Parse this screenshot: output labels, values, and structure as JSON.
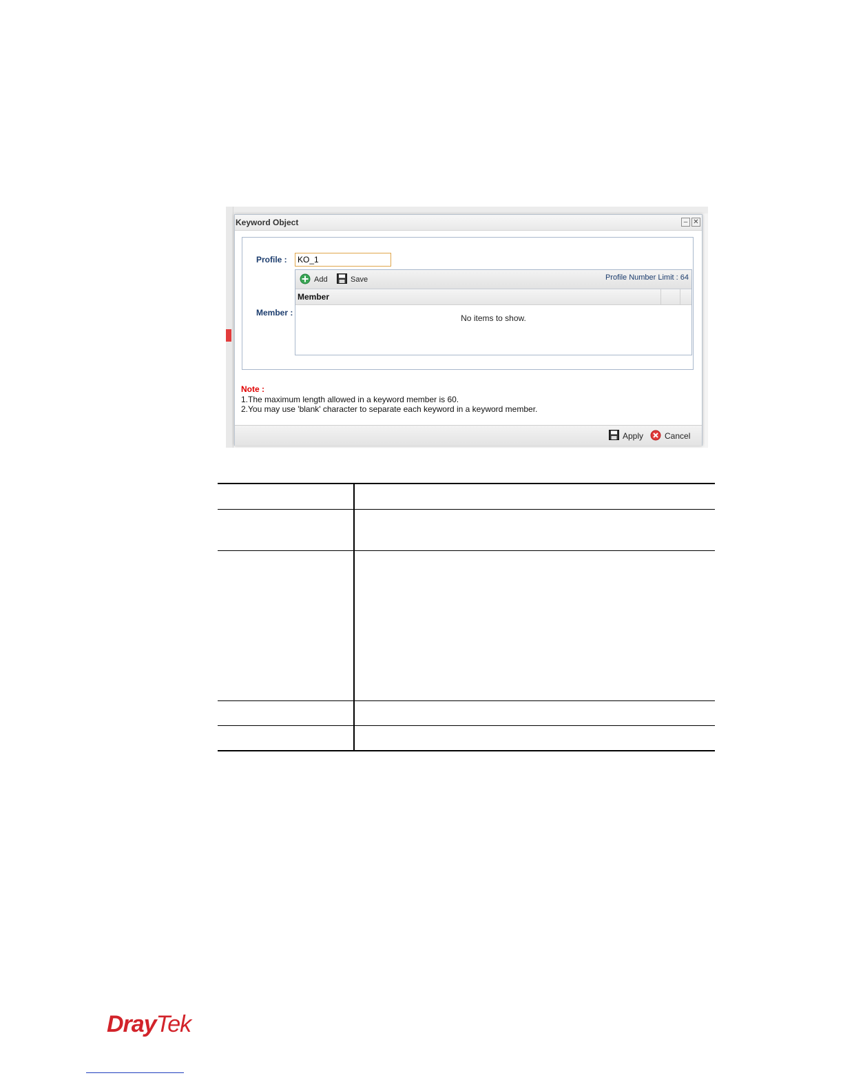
{
  "dialog": {
    "title": "Keyword Object",
    "minimize_glyph": "–",
    "close_glyph": "✕",
    "profile_label": "Profile :",
    "profile_value": "KO_1",
    "member_label": "Member :",
    "toolbar": {
      "add_label": "Add",
      "save_label": "Save",
      "limit_text": "Profile Number Limit : 64"
    },
    "grid": {
      "column_member": "Member",
      "empty_message": "No items to show."
    },
    "note": {
      "title": "Note :",
      "lines": [
        "1.The maximum length allowed in a keyword member is 60.",
        "2.You may use 'blank' character to separate each keyword in a keyword member."
      ]
    },
    "footer": {
      "apply_label": "Apply",
      "cancel_label": "Cancel"
    }
  },
  "colors": {
    "brand_red": "#d2232a",
    "label_blue": "#1c3d6e",
    "note_red": "#e00000",
    "input_border": "#e0a64a"
  },
  "logo": {
    "part1": "Dray",
    "part2": "Tek"
  }
}
